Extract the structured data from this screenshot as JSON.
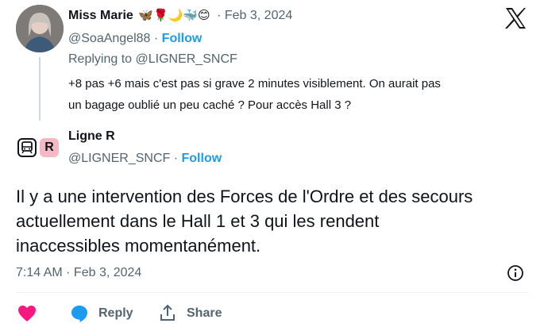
{
  "reply_tweet": {
    "display_name": "Miss Marie",
    "name_emojis": "🦋🌹🌙🐳😊",
    "dot": "·",
    "timestamp": "Feb 3, 2024",
    "handle": "@SoaAngel88",
    "follow_label": "Follow",
    "replying_to_prefix": "Replying to",
    "replying_to_handle": "@LIGNER_SNCF",
    "text_line1": "+8 pas +6 mais c'est pas si grave 2 minutes visiblement. On aurait pas",
    "text_line2": "un bagage oublié un peu caché ? Pour accès Hall 3 ?"
  },
  "main_tweet": {
    "display_name": "Ligne R",
    "avatar_letter": "R",
    "handle": "@LIGNER_SNCF",
    "dot": "·",
    "follow_label": "Follow",
    "text_line1": "Il y a une intervention des Forces de l'Ordre et des secours",
    "text_line2": "actuellement dans le Hall 1 et 3 qui les rendent",
    "text_line3": "inaccessibles momentanément.",
    "time_date": "7:14 AM · Feb 3, 2024"
  },
  "actions": {
    "reply_label": "Reply",
    "share_label": "Share"
  },
  "colors": {
    "like": "#f91880",
    "reply_bubble": "#1d9bf0",
    "follow": "#1d9bf0",
    "muted": "#536471"
  },
  "icons": [
    "x-logo-icon",
    "train-icon",
    "info-icon",
    "heart-icon",
    "comment-icon",
    "share-icon"
  ]
}
